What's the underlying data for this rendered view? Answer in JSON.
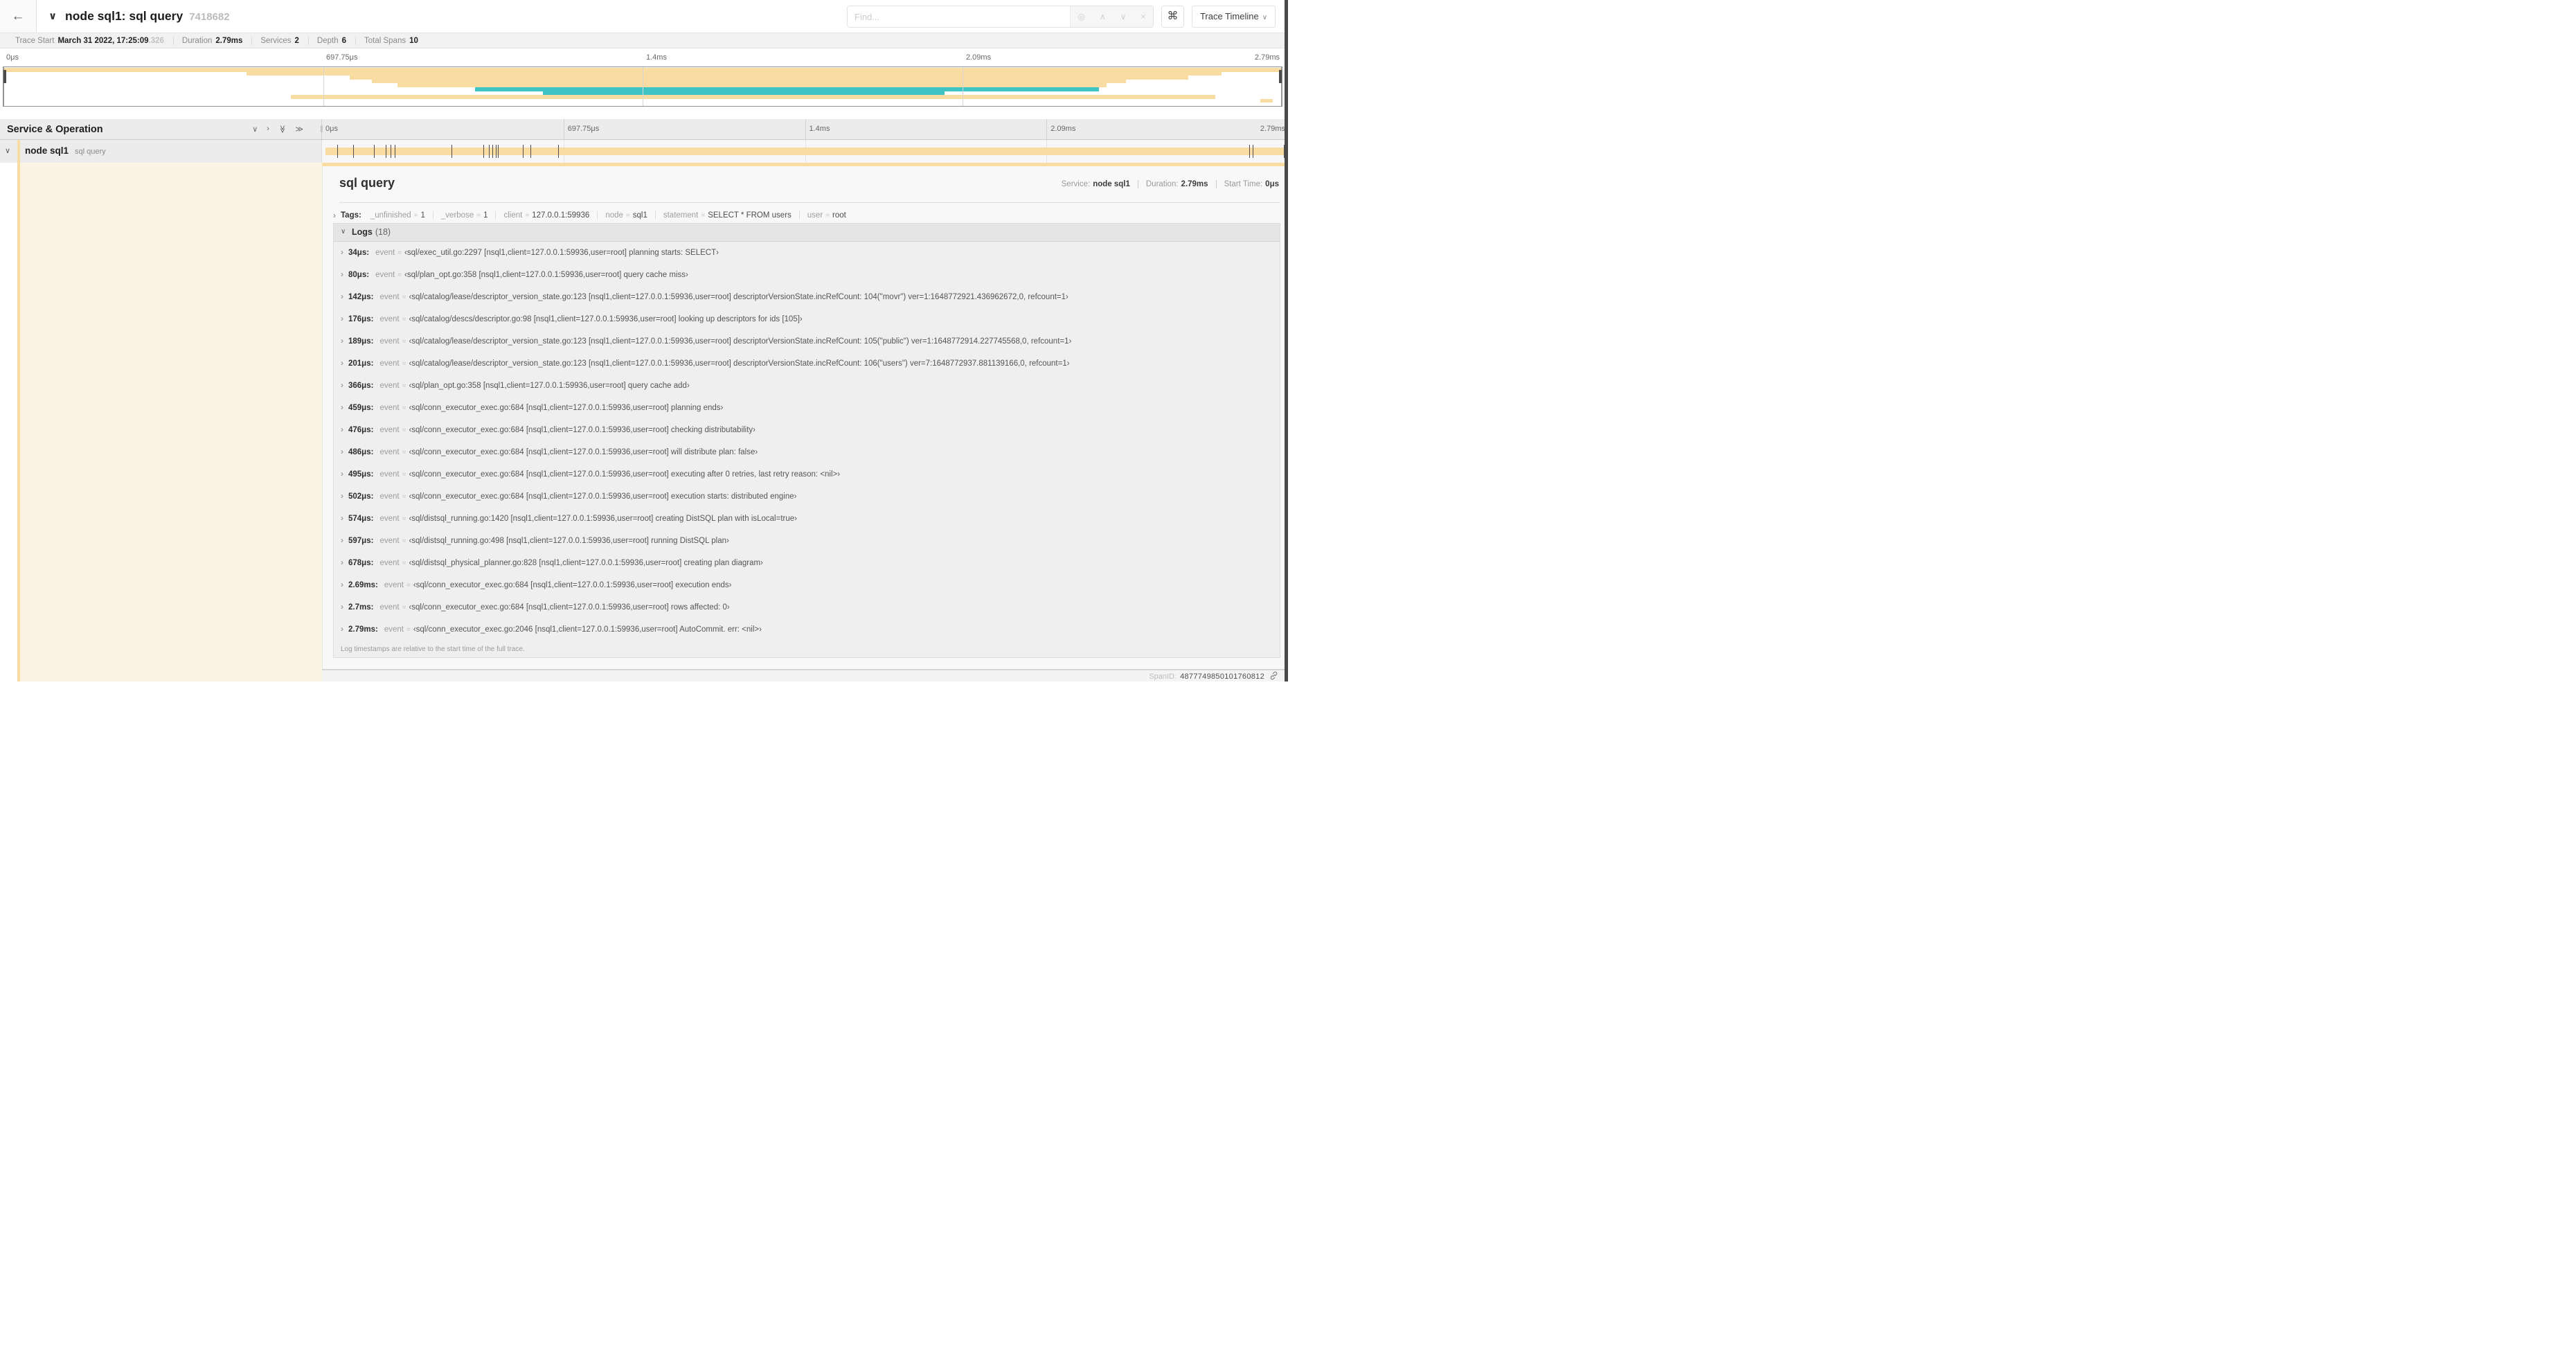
{
  "topbar": {
    "back_icon": "←",
    "collapse_icon": "∨",
    "title": "node sql1: sql query",
    "trace_id_short": "7418682",
    "find": {
      "placeholder": "Find...",
      "icons": [
        {
          "name": "focus-icon",
          "glyph": "◎"
        },
        {
          "name": "prev-match-icon",
          "glyph": "∧"
        },
        {
          "name": "next-match-icon",
          "glyph": "∨"
        },
        {
          "name": "clear-icon",
          "glyph": "×"
        }
      ]
    },
    "command_icon": "⌘",
    "view_button": {
      "label": "Trace Timeline",
      "chevron": "∨"
    }
  },
  "trace_meta": {
    "items": [
      {
        "label": "Trace Start",
        "value": "March 31 2022, 17:25:09",
        "suffix": ".326"
      },
      {
        "label": "Duration",
        "value": "2.79ms"
      },
      {
        "label": "Services",
        "value": "2"
      },
      {
        "label": "Depth",
        "value": "6"
      },
      {
        "label": "Total Spans",
        "value": "10"
      }
    ]
  },
  "timeline": {
    "header_label": "Service & Operation",
    "ticks": [
      "0μs",
      "697.75μs",
      "1.4ms",
      "2.09ms",
      "2.79ms"
    ],
    "duration_us": 2790,
    "collapse_icons": [
      {
        "name": "collapse-one-icon",
        "glyph": "∨",
        "rotate": false
      },
      {
        "name": "expand-one-icon",
        "glyph": "›",
        "rotate": false
      },
      {
        "name": "collapse-all-icon",
        "glyph": "≫",
        "rotate": true
      },
      {
        "name": "expand-all-icon",
        "glyph": "≫",
        "rotate": false
      }
    ],
    "row": {
      "service": "node sql1",
      "operation": "sql query"
    }
  },
  "minimap": {
    "spans": [
      {
        "start": 0.0,
        "end": 1.0,
        "color": "tan"
      },
      {
        "start": 0.19,
        "end": 0.953,
        "color": "tan"
      },
      {
        "start": 0.271,
        "end": 0.927,
        "color": "tan"
      },
      {
        "start": 0.288,
        "end": 0.878,
        "color": "tan"
      },
      {
        "start": 0.308,
        "end": 0.863,
        "color": "tan"
      },
      {
        "start": 0.369,
        "end": 0.857,
        "color": "teal"
      },
      {
        "start": 0.422,
        "end": 0.736,
        "color": "teal"
      },
      {
        "start": 0.225,
        "end": 0.948,
        "color": "tan"
      },
      {
        "start": 0.983,
        "end": 0.993,
        "color": "tan"
      }
    ]
  },
  "colors": {
    "tan": "#f8dca1",
    "teal": "#3fc3c3",
    "cream": "#fbf4e4"
  },
  "detail": {
    "title": "sql query",
    "meta": [
      {
        "label": "Service:",
        "value": "node sql1"
      },
      {
        "label": "Duration:",
        "value": "2.79ms"
      },
      {
        "label": "Start Time:",
        "value": "0μs"
      }
    ],
    "tags_label": "Tags:",
    "tags": [
      {
        "key": "_unfinished",
        "value": "1"
      },
      {
        "key": "_verbose",
        "value": "1"
      },
      {
        "key": "client",
        "value": "127.0.0.1:59936"
      },
      {
        "key": "node",
        "value": "sql1"
      },
      {
        "key": "statement",
        "value": "SELECT * FROM users"
      },
      {
        "key": "user",
        "value": "root"
      }
    ],
    "logs_label": "Logs",
    "logs_count": "(18)",
    "log_field": "event",
    "log_context": "nsql1,client=127.0.0.1:59936,user=root",
    "logs": [
      {
        "time": "34μs",
        "t": 34,
        "file": "sql/exec_util.go:2297",
        "message": "planning starts: SELECT"
      },
      {
        "time": "80μs",
        "t": 80,
        "file": "sql/plan_opt.go:358",
        "message": "query cache miss"
      },
      {
        "time": "142μs",
        "t": 142,
        "file": "sql/catalog/lease/descriptor_version_state.go:123",
        "message": "descriptorVersionState.incRefCount: 104(\"movr\") ver=1:1648772921.436962672,0, refcount=1"
      },
      {
        "time": "176μs",
        "t": 176,
        "file": "sql/catalog/descs/descriptor.go:98",
        "message": "looking up descriptors for ids [105]"
      },
      {
        "time": "189μs",
        "t": 189,
        "file": "sql/catalog/lease/descriptor_version_state.go:123",
        "message": "descriptorVersionState.incRefCount: 105(\"public\") ver=1:1648772914.227745568,0, refcount=1"
      },
      {
        "time": "201μs",
        "t": 201,
        "file": "sql/catalog/lease/descriptor_version_state.go:123",
        "message": "descriptorVersionState.incRefCount: 106(\"users\") ver=7:1648772937.881139166,0, refcount=1"
      },
      {
        "time": "366μs",
        "t": 366,
        "file": "sql/plan_opt.go:358",
        "message": "query cache add"
      },
      {
        "time": "459μs",
        "t": 459,
        "file": "sql/conn_executor_exec.go:684",
        "message": "planning ends"
      },
      {
        "time": "476μs",
        "t": 476,
        "file": "sql/conn_executor_exec.go:684",
        "message": "checking distributability"
      },
      {
        "time": "486μs",
        "t": 486,
        "file": "sql/conn_executor_exec.go:684",
        "message": "will distribute plan: false"
      },
      {
        "time": "495μs",
        "t": 495,
        "file": "sql/conn_executor_exec.go:684",
        "message": "executing after 0 retries, last retry reason: <nil>"
      },
      {
        "time": "502μs",
        "t": 502,
        "file": "sql/conn_executor_exec.go:684",
        "message": "execution starts: distributed engine"
      },
      {
        "time": "574μs",
        "t": 574,
        "file": "sql/distsql_running.go:1420",
        "message": "creating DistSQL plan with isLocal=true"
      },
      {
        "time": "597μs",
        "t": 597,
        "file": "sql/distsql_running.go:498",
        "message": "running DistSQL plan"
      },
      {
        "time": "678μs",
        "t": 678,
        "file": "sql/distsql_physical_planner.go:828",
        "message": "creating plan diagram"
      },
      {
        "time": "2.69ms",
        "t": 2690,
        "file": "sql/conn_executor_exec.go:684",
        "message": "execution ends"
      },
      {
        "time": "2.7ms",
        "t": 2700,
        "file": "sql/conn_executor_exec.go:684",
        "message": "rows affected: 0"
      },
      {
        "time": "2.79ms",
        "t": 2790,
        "file": "sql/conn_executor_exec.go:2046",
        "message": "AutoCommit. err: <nil>"
      }
    ],
    "logs_note": "Log timestamps are relative to the start time of the full trace.",
    "span_id_label": "SpanID:",
    "span_id": "4877749850101760812"
  }
}
